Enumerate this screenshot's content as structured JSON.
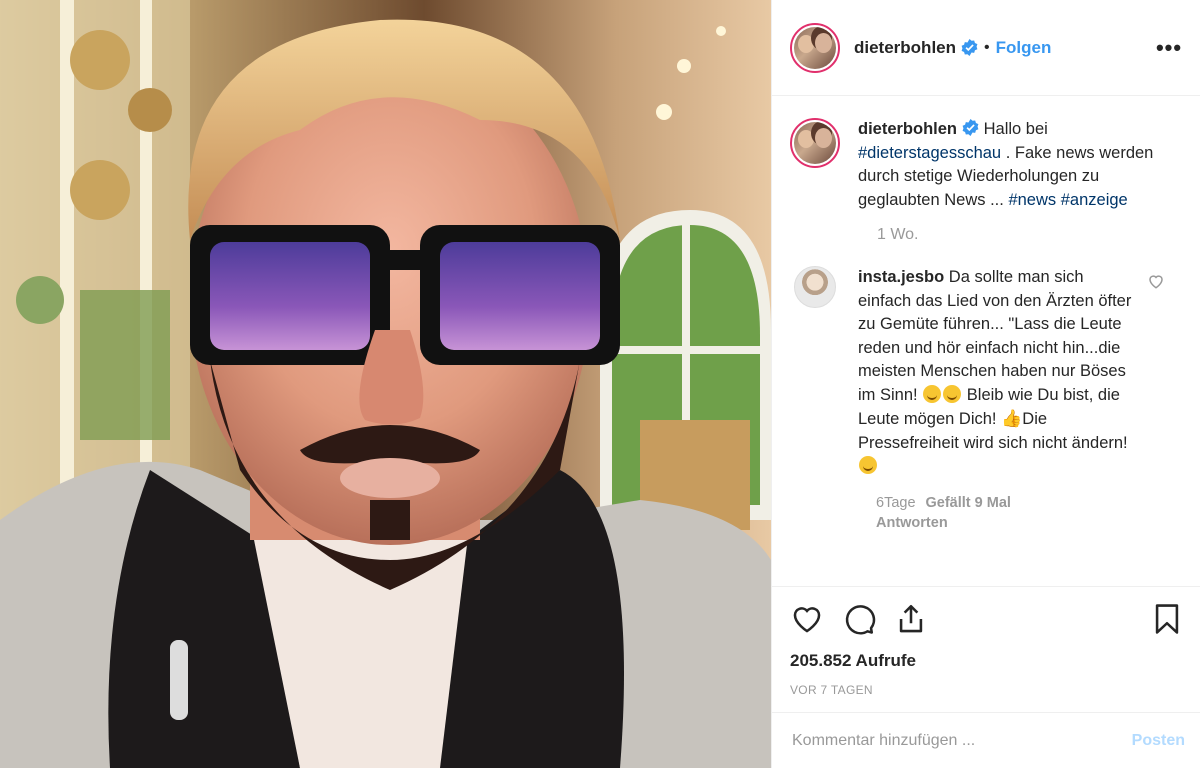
{
  "colors": {
    "link": "#3897f0",
    "hashtag": "#003569",
    "muted": "#999999",
    "verified": "#3897f0",
    "post_disabled": "#b3dbff"
  },
  "header": {
    "username": "dieterbohlen",
    "separator": "•",
    "follow_label": "Folgen",
    "more_icon": "more-horizontal-icon"
  },
  "caption": {
    "username": "dieterbohlen",
    "text_1": "Hallo bei",
    "tag_1": "#dieterstagesschau",
    "text_2": ". Fake news werden durch stetige Wiederholungen zu geglaubten News ...",
    "tag_2": "#news",
    "tag_3": "#anzeige",
    "age": "1 Wo."
  },
  "comment": {
    "username": "insta.jesbo",
    "text_1": "Da sollte man sich einfach das Lied von den Ärzten öfter zu Gemüte führen... \"Lass die Leute reden und hör einfach nicht hin...die meisten Menschen haben nur Böses im Sinn!",
    "text_2": "Bleib wie Du bist, die Leute mögen Dich!",
    "text_3": "Die Pressefreiheit wird sich nicht ändern!",
    "time": "6Tage",
    "likes": "Gefällt 9 Mal",
    "reply_label": "Antworten"
  },
  "actions": {
    "views": "205.852 Aufrufe",
    "posted_ago": "VOR 7 TAGEN"
  },
  "add_comment": {
    "placeholder": "Kommentar hinzufügen ...",
    "post_label": "Posten"
  }
}
